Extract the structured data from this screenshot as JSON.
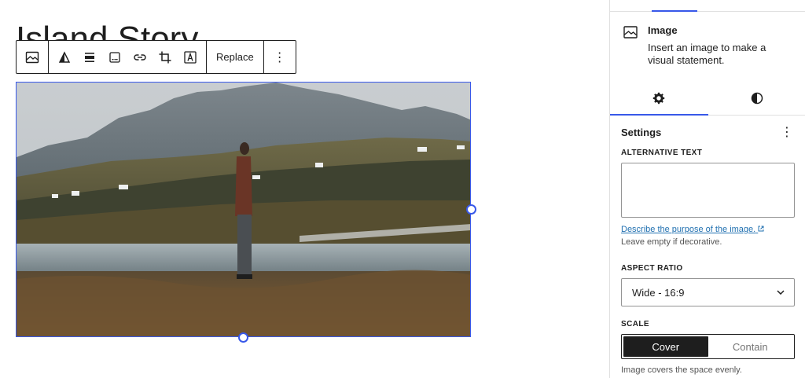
{
  "editor": {
    "heading_text": "Island Story",
    "toolbar": {
      "replace_label": "Replace",
      "more_label": "⋮"
    }
  },
  "sidebar": {
    "block_card": {
      "title": "Image",
      "description": "Insert an image to make a visual statement."
    },
    "settings": {
      "title": "Settings",
      "alt_text_label": "ALTERNATIVE TEXT",
      "alt_text_value": "",
      "describe_link": "Describe the purpose of the image.",
      "describe_help": "Leave empty if decorative.",
      "aspect_label": "ASPECT RATIO",
      "aspect_value": "Wide - 16:9",
      "scale_label": "SCALE",
      "scale_options": [
        "Cover",
        "Contain"
      ],
      "scale_selected": "Cover",
      "scale_help": "Image covers the space evenly."
    }
  },
  "colors": {
    "accent": "#3858e9",
    "link": "#2271b1",
    "text": "#1e1e1e",
    "border": "#e0e0e0"
  },
  "icons": [
    "image-icon",
    "duotone-icon",
    "align-icon",
    "caption-icon",
    "link-icon",
    "crop-icon",
    "text-overlay-icon",
    "gear-icon",
    "contrast-icon",
    "external-link-icon",
    "chevron-down-icon"
  ]
}
